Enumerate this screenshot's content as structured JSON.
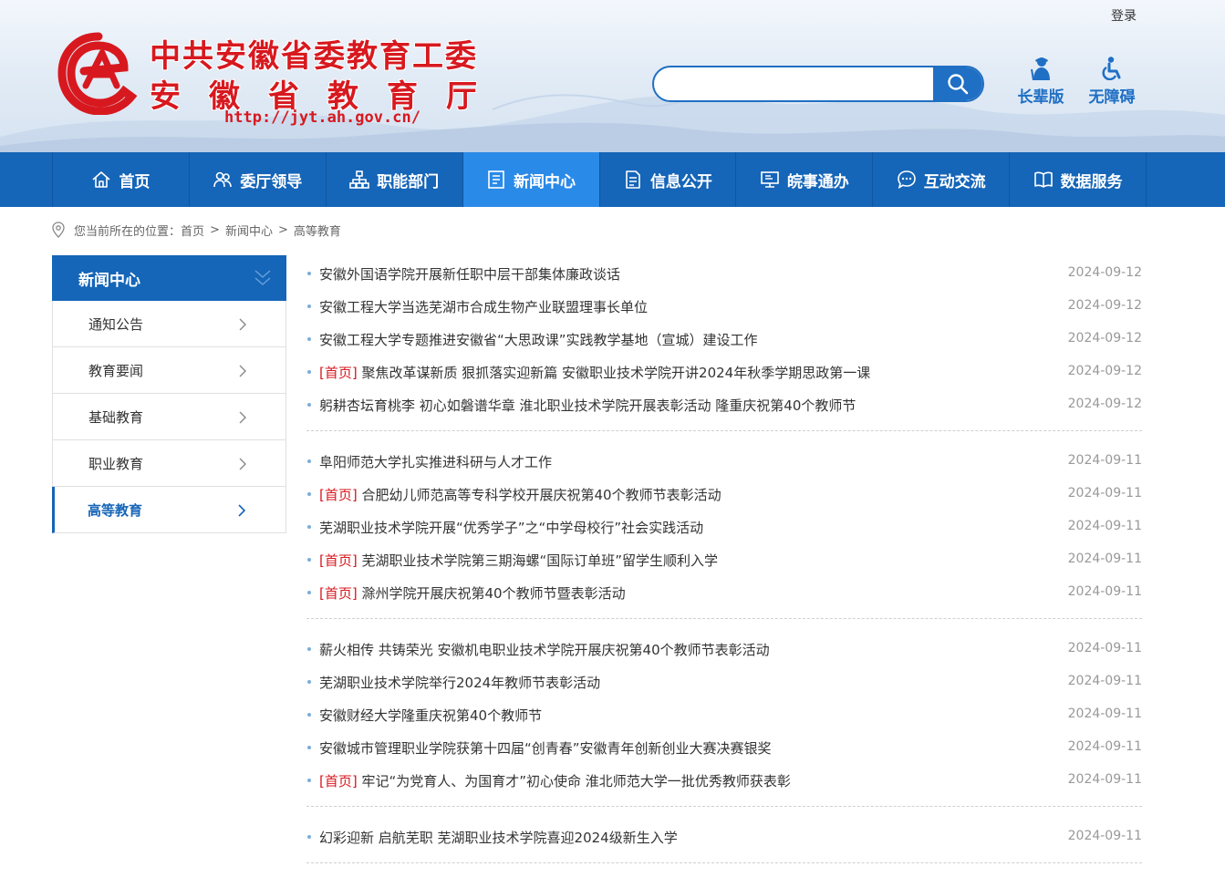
{
  "header": {
    "login_label": "登录",
    "site_name_line1": "中共安徽省委教育工委",
    "site_name_line2": "安徽省教育厅",
    "site_url": "http://jyt.ah.gov.cn/",
    "search_placeholder": "",
    "tools": [
      {
        "label": "长辈版",
        "icon": "elderly-person-icon"
      },
      {
        "label": "无障碍",
        "icon": "wheelchair-icon"
      }
    ]
  },
  "nav": {
    "items": [
      {
        "label": "首页",
        "icon": "home-icon"
      },
      {
        "label": "委厅领导",
        "icon": "leaders-icon"
      },
      {
        "label": "职能部门",
        "icon": "org-chart-icon"
      },
      {
        "label": "新闻中心",
        "icon": "news-icon",
        "active": true
      },
      {
        "label": "信息公开",
        "icon": "document-icon"
      },
      {
        "label": "皖事通办",
        "icon": "monitor-icon"
      },
      {
        "label": "互动交流",
        "icon": "chat-icon"
      },
      {
        "label": "数据服务",
        "icon": "book-icon"
      }
    ]
  },
  "breadcrumb": {
    "prefix": "您当前所在的位置：",
    "items": [
      "首页",
      "新闻中心",
      "高等教育"
    ],
    "separator": ">"
  },
  "sidebar": {
    "title": "新闻中心",
    "items": [
      {
        "label": "通知公告"
      },
      {
        "label": "教育要闻"
      },
      {
        "label": "基础教育"
      },
      {
        "label": "职业教育"
      },
      {
        "label": "高等教育",
        "active": true
      }
    ]
  },
  "news": {
    "tag_label": "首页",
    "groups": [
      [
        {
          "title": "安徽外国语学院开展新任职中层干部集体廉政谈话",
          "date": "2024-09-12",
          "tagged": false
        },
        {
          "title": "安徽工程大学当选芜湖市合成生物产业联盟理事长单位",
          "date": "2024-09-12",
          "tagged": false
        },
        {
          "title": "安徽工程大学专题推进安徽省“大思政课”实践教学基地（宣城）建设工作",
          "date": "2024-09-12",
          "tagged": false
        },
        {
          "title": "聚焦改革谋新质 狠抓落实迎新篇 安徽职业技术学院开讲2024年秋季学期思政第一课",
          "date": "2024-09-12",
          "tagged": true
        },
        {
          "title": "躬耕杏坛育桃李 初心如磐谱华章 淮北职业技术学院开展表彰活动 隆重庆祝第40个教师节",
          "date": "2024-09-12",
          "tagged": false
        }
      ],
      [
        {
          "title": "阜阳师范大学扎实推进科研与人才工作",
          "date": "2024-09-11",
          "tagged": false
        },
        {
          "title": "合肥幼儿师范高等专科学校开展庆祝第40个教师节表彰活动",
          "date": "2024-09-11",
          "tagged": true
        },
        {
          "title": "芜湖职业技术学院开展“优秀学子”之“中学母校行”社会实践活动",
          "date": "2024-09-11",
          "tagged": false
        },
        {
          "title": "芜湖职业技术学院第三期海螺“国际订单班”留学生顺利入学",
          "date": "2024-09-11",
          "tagged": true
        },
        {
          "title": "滁州学院开展庆祝第40个教师节暨表彰活动",
          "date": "2024-09-11",
          "tagged": true
        }
      ],
      [
        {
          "title": "薪火相传 共铸荣光 安徽机电职业技术学院开展庆祝第40个教师节表彰活动",
          "date": "2024-09-11",
          "tagged": false
        },
        {
          "title": "芜湖职业技术学院举行2024年教师节表彰活动",
          "date": "2024-09-11",
          "tagged": false
        },
        {
          "title": "安徽财经大学隆重庆祝第40个教师节",
          "date": "2024-09-11",
          "tagged": false
        },
        {
          "title": "安徽城市管理职业学院获第十四届“创青春”安徽青年创新创业大赛决赛银奖",
          "date": "2024-09-11",
          "tagged": false
        },
        {
          "title": "牢记“为党育人、为国育才”初心使命 淮北师范大学一批优秀教师获表彰",
          "date": "2024-09-11",
          "tagged": true
        }
      ],
      [
        {
          "title": "幻彩迎新 启航芜职 芜湖职业技术学院喜迎2024级新生入学",
          "date": "2024-09-11",
          "tagged": false
        }
      ]
    ]
  },
  "colors": {
    "brand_blue": "#1565b8",
    "nav_active": "#2a8ae8",
    "title_red": "#d7191f",
    "date_gray": "#999999"
  }
}
